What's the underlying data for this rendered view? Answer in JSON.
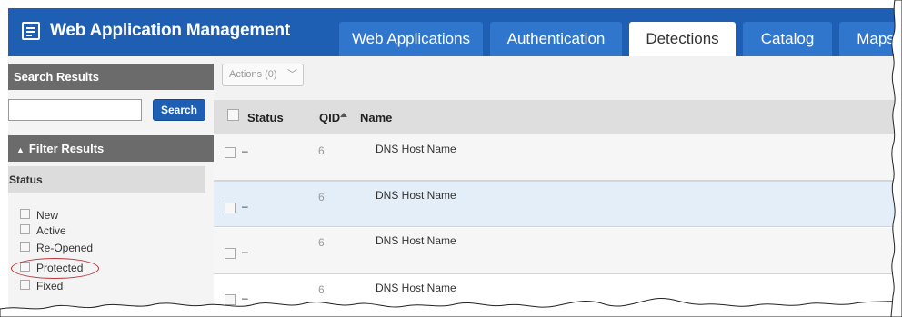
{
  "header": {
    "title": "Web Application Management",
    "tabs": [
      {
        "label": "Web Applications",
        "active": false
      },
      {
        "label": "Authentication",
        "active": false
      },
      {
        "label": "Detections",
        "active": true
      },
      {
        "label": "Catalog",
        "active": false
      },
      {
        "label": "Maps",
        "active": false
      }
    ]
  },
  "sidebar": {
    "search_results_label": "Search Results",
    "search_button_label": "Search",
    "search_input_value": "",
    "filter_results_label": "Filter Results",
    "status_label": "Status",
    "status_filters": [
      {
        "label": "New",
        "checked": false
      },
      {
        "label": "Active",
        "checked": false
      },
      {
        "label": "Re-Opened",
        "checked": false
      },
      {
        "label": "Protected",
        "checked": false,
        "highlighted": true
      },
      {
        "label": "Fixed",
        "checked": false
      }
    ]
  },
  "toolbar": {
    "actions_label": "Actions (0)"
  },
  "table": {
    "columns": {
      "status": "Status",
      "qid": "QID",
      "name": "Name"
    },
    "rows": [
      {
        "status": "–",
        "qid": "6",
        "name": "DNS Host Name"
      },
      {
        "status": "–",
        "qid": "6",
        "name": "DNS Host Name"
      },
      {
        "status": "–",
        "qid": "6",
        "name": "DNS Host Name"
      },
      {
        "status": "–",
        "qid": "6",
        "name": "DNS Host Name"
      }
    ]
  },
  "colors": {
    "header_bg": "#1f5fb3",
    "tab_bg": "#2f76cc",
    "sidebar_header_bg": "#6b6b6b",
    "highlight_circle": "#b5353a",
    "selected_row": "#e3eef9"
  }
}
